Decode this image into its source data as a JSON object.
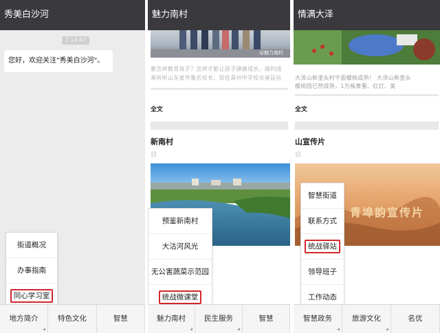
{
  "panel1": {
    "title": "秀美白沙河",
    "time": "7:14:47",
    "greeting": "您好，欢迎关注\"秀美白沙河\"。",
    "popup": [
      "街道概况",
      "办事指南",
      "同心学习室"
    ],
    "menu": [
      "地方简介",
      "特色文化",
      "智慧"
    ]
  },
  "panel2": {
    "title": "魅力南村",
    "watermark": "@魅力南村",
    "text1": "要怎样教育孩子？怎样才能让孩子健康成长，顺利成",
    "text2": "来听听山东省齐鲁名校长、现任青州中学校长崔廷俭",
    "label_fulltext": "全文",
    "article_title": "新南村",
    "article_meta": "日",
    "popup": [
      "预鉴新南村",
      "大沽河风光",
      "无公害蔬菜示范园",
      "统战微课堂"
    ],
    "menu": [
      "魅力南村",
      "民生服务",
      "智慧"
    ]
  },
  "panel3": {
    "title": "情满大泽",
    "text1": "大泽山新里头村干面樱桃成熟！     大泽山新里头",
    "text2": "樱桃园已然成熟，1万株黄蜜、红灯、美",
    "label_fulltext": "全文",
    "article_title": "山宣传片",
    "article_meta": "日",
    "banner_text": "青埠韵宣传片",
    "popup": [
      "智慧街道",
      "联系方式",
      "统战驿站",
      "领导班子",
      "工作动态"
    ],
    "menu": [
      "智慧政务",
      "旅游文化",
      "名优"
    ]
  },
  "colors": {
    "titlebar": "#3a3a3e",
    "highlight": "#d3262c",
    "background": "#ececec"
  }
}
